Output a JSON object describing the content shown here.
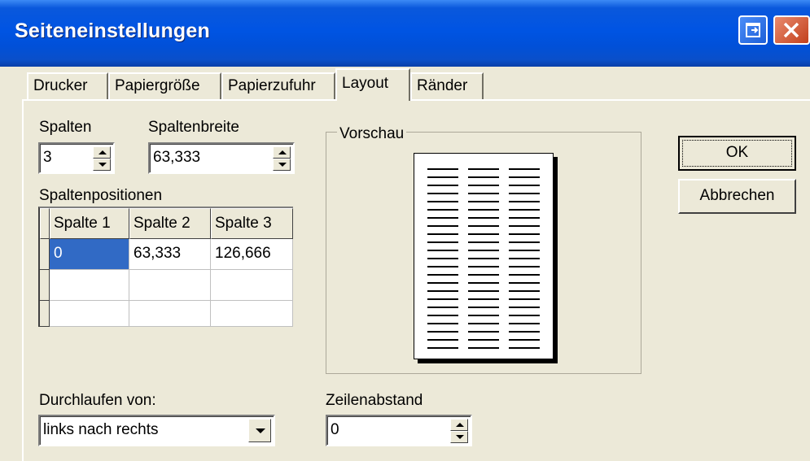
{
  "window": {
    "title": "Seiteneinstellungen"
  },
  "tabs": [
    "Drucker",
    "Papiergröße",
    "Papierzufuhr",
    "Layout",
    "Ränder"
  ],
  "spalten": {
    "label": "Spalten",
    "value": "3"
  },
  "spaltenbreite": {
    "label": "Spaltenbreite",
    "value": "63,333"
  },
  "positions": {
    "label": "Spaltenpositionen",
    "headers": [
      "Spalte 1",
      "Spalte 2",
      "Spalte 3"
    ],
    "rows": [
      [
        "0",
        "63,333",
        "126,666"
      ],
      [
        "",
        "",
        ""
      ],
      [
        "",
        "",
        ""
      ]
    ]
  },
  "preview": {
    "label": "Vorschau"
  },
  "buttons": {
    "ok": "OK",
    "cancel": "Abbrechen"
  },
  "durchlaufen": {
    "label": "Durchlaufen von:",
    "value": "links nach rechts"
  },
  "zeilenabstand": {
    "label": "Zeilenabstand",
    "value": "0"
  },
  "colors": {
    "titlebar": "#0054e3",
    "dialog": "#ece9d8",
    "selection": "#316ac5"
  }
}
